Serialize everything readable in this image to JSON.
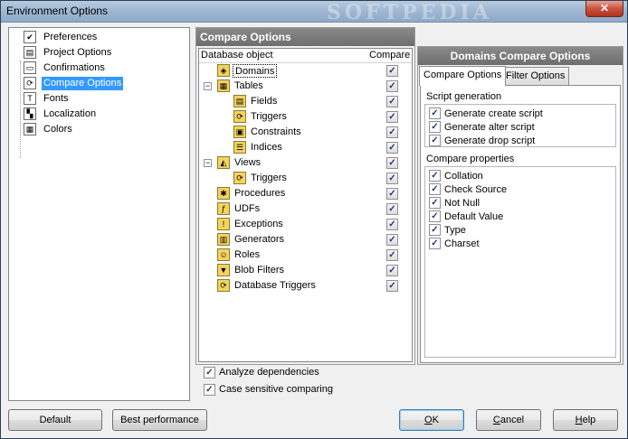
{
  "window": {
    "title": "Environment Options",
    "watermark": "SOFTPEDIA",
    "close_label": "✕"
  },
  "nav": {
    "items": [
      {
        "label": "Preferences",
        "icon": "check-icon",
        "glyph": "✔"
      },
      {
        "label": "Project Options",
        "icon": "document-icon",
        "glyph": "▤"
      },
      {
        "label": "Confirmations",
        "icon": "dialog-icon",
        "glyph": "▭"
      },
      {
        "label": "Compare Options",
        "icon": "compare-icon",
        "glyph": "⟳",
        "selected": true
      },
      {
        "label": "Fonts",
        "icon": "font-icon",
        "glyph": "T"
      },
      {
        "label": "Localization",
        "icon": "flag-icon",
        "glyph": "▚"
      },
      {
        "label": "Colors",
        "icon": "palette-icon",
        "glyph": "▦"
      }
    ]
  },
  "compare": {
    "header": "Compare Options",
    "col_object": "Database object",
    "col_compare": "Compare",
    "rows": [
      {
        "label": "Domains",
        "icon": "domain-icon",
        "glyph": "◈",
        "level": 1,
        "focused": true
      },
      {
        "label": "Tables",
        "icon": "table-icon",
        "glyph": "▦",
        "level": 0,
        "expander": "−"
      },
      {
        "label": "Fields",
        "icon": "field-icon",
        "glyph": "▤",
        "level": 2
      },
      {
        "label": "Triggers",
        "icon": "trigger-icon",
        "glyph": "⟳",
        "level": 2
      },
      {
        "label": "Constraints",
        "icon": "constraint-icon",
        "glyph": "▣",
        "level": 2
      },
      {
        "label": "Indices",
        "icon": "index-icon",
        "glyph": "☰",
        "level": 2
      },
      {
        "label": "Views",
        "icon": "view-icon",
        "glyph": "◭",
        "level": 0,
        "expander": "−"
      },
      {
        "label": "Triggers",
        "icon": "trigger-icon",
        "glyph": "⟳",
        "level": 2
      },
      {
        "label": "Procedures",
        "icon": "procedure-icon",
        "glyph": "✱",
        "level": 1
      },
      {
        "label": "UDFs",
        "icon": "udf-icon",
        "glyph": "ƒ",
        "level": 1
      },
      {
        "label": "Exceptions",
        "icon": "warning-icon",
        "glyph": "!",
        "level": 1
      },
      {
        "label": "Generators",
        "icon": "generator-icon",
        "glyph": "▥",
        "level": 1
      },
      {
        "label": "Roles",
        "icon": "role-icon",
        "glyph": "☺",
        "level": 1
      },
      {
        "label": "Blob Filters",
        "icon": "filter-icon",
        "glyph": "▼",
        "level": 1
      },
      {
        "label": "Database Triggers",
        "icon": "db-trigger-icon",
        "glyph": "⟳",
        "level": 1
      }
    ],
    "check_mark": "✓"
  },
  "options": {
    "analyze": "Analyze dependencies",
    "case": "Case sensitive comparing"
  },
  "domains": {
    "header": "Domains Compare Options",
    "tab_compare": "Compare Options",
    "tab_filter": "Filter Options",
    "script_title": "Script generation",
    "script_items": [
      "Generate create script",
      "Generate alter script",
      "Generate drop script"
    ],
    "props_title": "Compare properties",
    "props_items": [
      "Collation",
      "Check Source",
      "Not Null",
      "Default Value",
      "Type",
      "Charset"
    ]
  },
  "buttons": {
    "default": "Default",
    "best": "Best performance",
    "ok_pre": "",
    "ok_u": "O",
    "ok_post": "K",
    "cancel_pre": "",
    "cancel_u": "C",
    "cancel_post": "ancel",
    "help_pre": "",
    "help_u": "H",
    "help_post": "elp"
  }
}
